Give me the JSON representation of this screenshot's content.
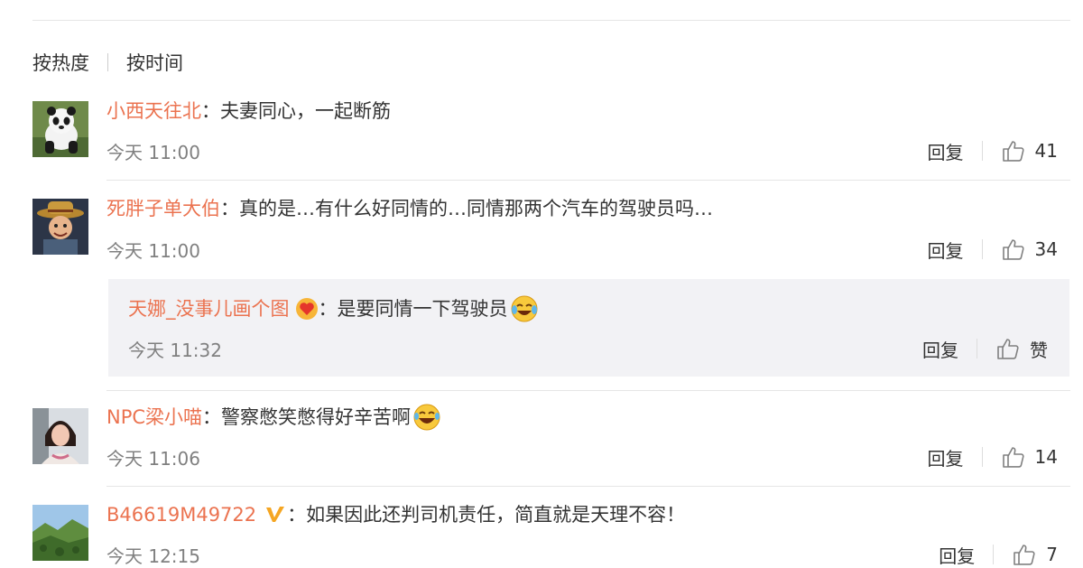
{
  "sort": {
    "hot_label": "按热度",
    "time_label": "按时间"
  },
  "comments": [
    {
      "username": "小西天往北",
      "colon": "：",
      "text": "夫妻同心，一起断筋",
      "time": "今天 11:00",
      "reply_label": "回复",
      "likes": "41"
    },
    {
      "username": "死胖子单大伯",
      "colon": "：",
      "text": "真的是…有什么好同情的…同情那两个汽车的驾驶员吗…",
      "time": "今天 11:00",
      "reply_label": "回复",
      "likes": "34",
      "sub_reply": {
        "username": "天娜_没事儿画个图",
        "colon": "：",
        "text": "是要同情一下驾驶员",
        "time": "今天 11:32",
        "reply_label": "回复",
        "like_label": "赞"
      }
    },
    {
      "username": "NPC梁小喵",
      "colon": "：",
      "text": "警察憋笑憋得好辛苦啊",
      "time": "今天 11:06",
      "reply_label": "回复",
      "likes": "14"
    },
    {
      "username": "B46619M49722",
      "colon": "：",
      "text": "如果因此还判司机责任，简直就是天理不容！",
      "time": "今天 12:15",
      "reply_label": "回复",
      "likes": "7"
    }
  ],
  "colors": {
    "username": "#eb7350",
    "text": "#333333",
    "meta": "#808080",
    "reply_bg": "#f2f2f5"
  }
}
